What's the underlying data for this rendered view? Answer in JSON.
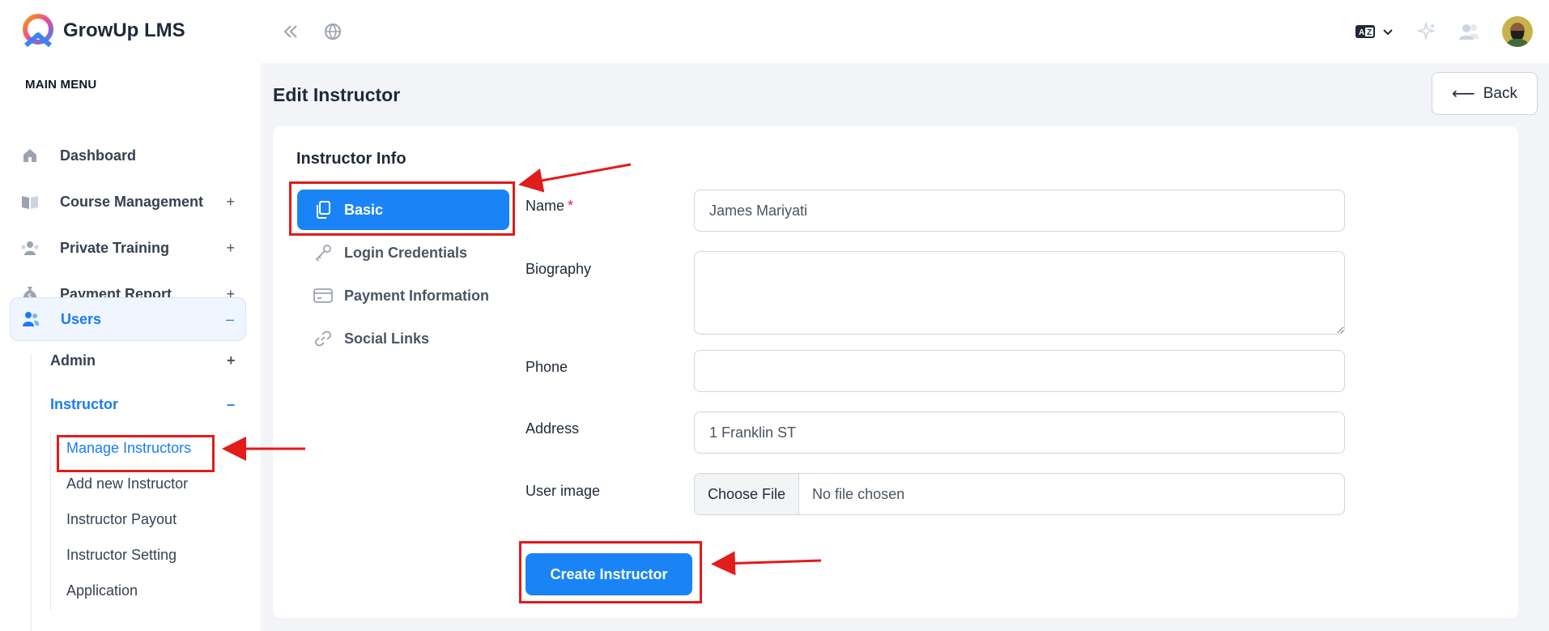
{
  "app": {
    "name": "GrowUp LMS"
  },
  "topbar": {
    "collapse_icon": "double-chevron-left-icon",
    "globe_icon": "globe-icon",
    "language_icon": "translate-icon",
    "sparkle_icon": "sparkle-icon",
    "users_icon": "users-icon"
  },
  "sidebar": {
    "menu_title": "MAIN MENU",
    "items": [
      {
        "label": "Dashboard",
        "icon": "home-icon",
        "toggle": ""
      },
      {
        "label": "Course Management",
        "icon": "book-icon",
        "toggle": "+"
      },
      {
        "label": "Private Training",
        "icon": "training-icon",
        "toggle": "+"
      },
      {
        "label": "Payment Report",
        "icon": "money-bag-icon",
        "toggle": "+"
      },
      {
        "label": "Users",
        "icon": "users-icon",
        "toggle": "–"
      }
    ],
    "users_sub": [
      {
        "label": "Admin",
        "toggle": "+"
      },
      {
        "label": "Instructor",
        "toggle": "–"
      }
    ],
    "instructor_sub": [
      "Manage Instructors",
      "Add new Instructor",
      "Instructor Payout",
      "Instructor Setting",
      "Application"
    ]
  },
  "page": {
    "title": "Edit Instructor",
    "back_label": "Back"
  },
  "card": {
    "title": "Instructor Info",
    "tabs": [
      {
        "label": "Basic",
        "icon": "copy-icon"
      },
      {
        "label": "Login Credentials",
        "icon": "key-icon"
      },
      {
        "label": "Payment Information",
        "icon": "credit-card-icon"
      },
      {
        "label": "Social Links",
        "icon": "link-icon"
      }
    ]
  },
  "form": {
    "name_label": "Name",
    "name_required": "*",
    "name_value": "James Mariyati",
    "biography_label": "Biography",
    "biography_value": "",
    "phone_label": "Phone",
    "phone_value": "",
    "address_label": "Address",
    "address_value": "1 Franklin ST",
    "image_label": "User image",
    "file_button": "Choose File",
    "file_status": "No file chosen",
    "submit_label": "Create Instructor"
  },
  "colors": {
    "accent": "#1a84f7",
    "annotation": "#e21b1b"
  }
}
